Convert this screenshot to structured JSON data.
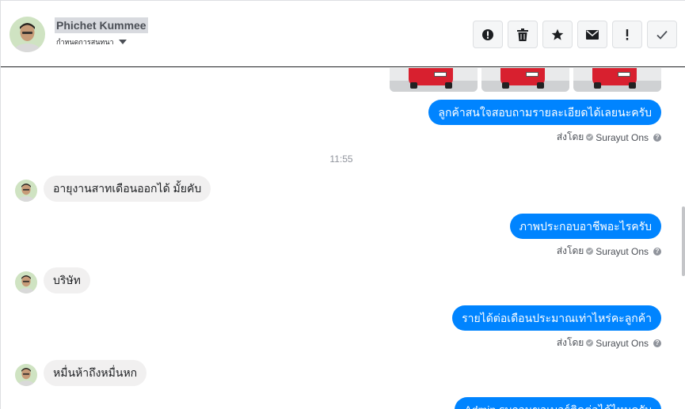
{
  "header": {
    "contact_name": "Phichet Kummee",
    "contact_status": "กำหนดการสนทนา"
  },
  "actions": [
    {
      "name": "report-icon"
    },
    {
      "name": "trash-icon"
    },
    {
      "name": "star-icon"
    },
    {
      "name": "envelope-icon"
    },
    {
      "name": "exclamation-icon"
    },
    {
      "name": "checkmark-icon"
    }
  ],
  "messages": [
    {
      "dir": "out",
      "text": "ลูกค้าสนใจสอบถามรายละเอียดได้เลยนะครับ"
    },
    {
      "dir": "out",
      "text": "ภาพประกอบอาชีพอะไรครับ"
    },
    {
      "dir": "out",
      "text": "รายได้ต่อเดือนประมาณเท่าไหร่คะลูกค้า"
    },
    {
      "dir": "out",
      "text": "Admin รบกวนขอเบอร์ติดต่อได้ไหมครับ"
    },
    {
      "dir": "in",
      "text": "อายุงานสาทเดือนออกได้ มั้ยคับ"
    },
    {
      "dir": "in",
      "text": "บริษัท"
    },
    {
      "dir": "in",
      "text": "หมื่นห้าถึงหมื่นหก"
    }
  ],
  "sent_by": {
    "prefix": "ส่งโดย",
    "agent": "Surayut Ons"
  },
  "time_separator": "11:55",
  "colors": {
    "outgoing_bubble": "#0084ff",
    "incoming_bubble": "#f1f0f0"
  }
}
